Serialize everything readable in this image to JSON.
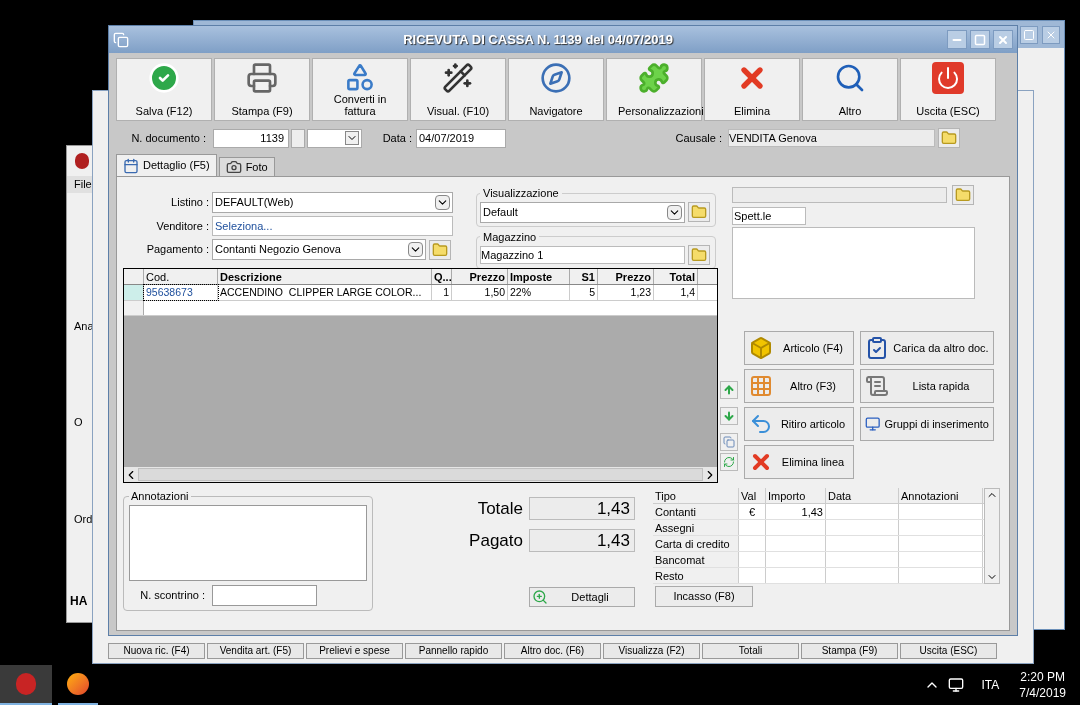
{
  "background": {
    "left_menu": "File",
    "left_labels": [
      "Ana",
      "O",
      "Ord"
    ],
    "left_footer": "HA",
    "bottom_buttons": [
      "Nuova ric. (F4)",
      "Vendita art. (F5)",
      "Prelievi e spese",
      "Pannello rapido",
      "Altro doc. (F6)",
      "Visualizza (F2)",
      "Totali",
      "Stampa (F9)",
      "Uscita (ESC)"
    ]
  },
  "window": {
    "title": "RICEVUTA DI CASSA N. 1139 del 04/07/2019"
  },
  "toolbar": [
    {
      "label": "Salva (F12)",
      "kind": "save"
    },
    {
      "label": "Stampa (F9)",
      "kind": "print"
    },
    {
      "label": "Converti in fattura",
      "kind": "convert"
    },
    {
      "label": "Visual. (F10)",
      "kind": "wand"
    },
    {
      "label": "Navigatore",
      "kind": "compass"
    },
    {
      "label": "Personalizzazioni",
      "kind": "puzzle"
    },
    {
      "label": "Elimina",
      "kind": "delete"
    },
    {
      "label": "Altro",
      "kind": "search"
    },
    {
      "label": "Uscita (ESC)",
      "kind": "exit"
    }
  ],
  "header": {
    "doc_label": "N. documento :",
    "doc_number": "1139",
    "date_label": "Data :",
    "date": "04/07/2019",
    "causale_label": "Causale :",
    "causale": "VENDITA Genova"
  },
  "tabs": [
    {
      "label": "Dettaglio (F5)",
      "selected": true,
      "kind": "calendar"
    },
    {
      "label": "Foto",
      "selected": false,
      "kind": "camera"
    }
  ],
  "form": {
    "listino_label": "Listino :",
    "listino": "DEFAULT(Web)",
    "venditore_label": "Venditore :",
    "venditore_placeholder": "Seleziona...",
    "pagamento_label": "Pagamento :",
    "pagamento": "Contanti Negozio Genova"
  },
  "visualizzazione": {
    "legend": "Visualizzazione",
    "value": "Default"
  },
  "magazzino": {
    "legend": "Magazzino",
    "value": "Magazzino 1"
  },
  "recipient": {
    "salutation": "Spett.le"
  },
  "grid": {
    "columns": [
      "Cod.",
      "Descrizione",
      "Q...",
      "Prezzo",
      "Imposte",
      "S1",
      "Prezzo",
      "Total"
    ],
    "rows": [
      {
        "selected": true,
        "cells": [
          "95638673",
          "ACCENDINO  CLIPPER LARGE COLOR...",
          "1",
          "1,50",
          "22%",
          "5",
          "1,23",
          "1,4"
        ]
      }
    ]
  },
  "actions": [
    {
      "label": "Articolo (F4)",
      "kind": "article"
    },
    {
      "label": "Carica da altro doc.",
      "kind": "load"
    },
    {
      "label": "Altro (F3)",
      "kind": "grid"
    },
    {
      "label": "Lista rapida",
      "kind": "list"
    },
    {
      "label": "Ritiro articolo",
      "kind": "return"
    },
    {
      "label": "Gruppi di inserimento",
      "kind": "groups"
    },
    {
      "label": "Elimina linea",
      "kind": "delete"
    }
  ],
  "annotations": {
    "legend": "Annotazioni",
    "receipt_label": "N. scontrino :"
  },
  "totals": [
    {
      "label": "Totale",
      "value": "1,43"
    },
    {
      "label": "Pagato",
      "value": "1,43"
    }
  ],
  "details_button": "Dettagli",
  "payments": {
    "columns": [
      "Tipo",
      "Val",
      "Importo",
      "Data",
      "Annotazioni"
    ],
    "rows": [
      [
        "Contanti",
        "€",
        "1,43"
      ],
      [
        "Assegni"
      ],
      [
        "Carta di credito"
      ],
      [
        "Bancomat"
      ],
      [
        "Resto"
      ]
    ]
  },
  "incasso_button": "Incasso (F8)",
  "taskbar": {
    "language": "ITA",
    "time": "2:20 PM",
    "date": "7/4/2019"
  }
}
